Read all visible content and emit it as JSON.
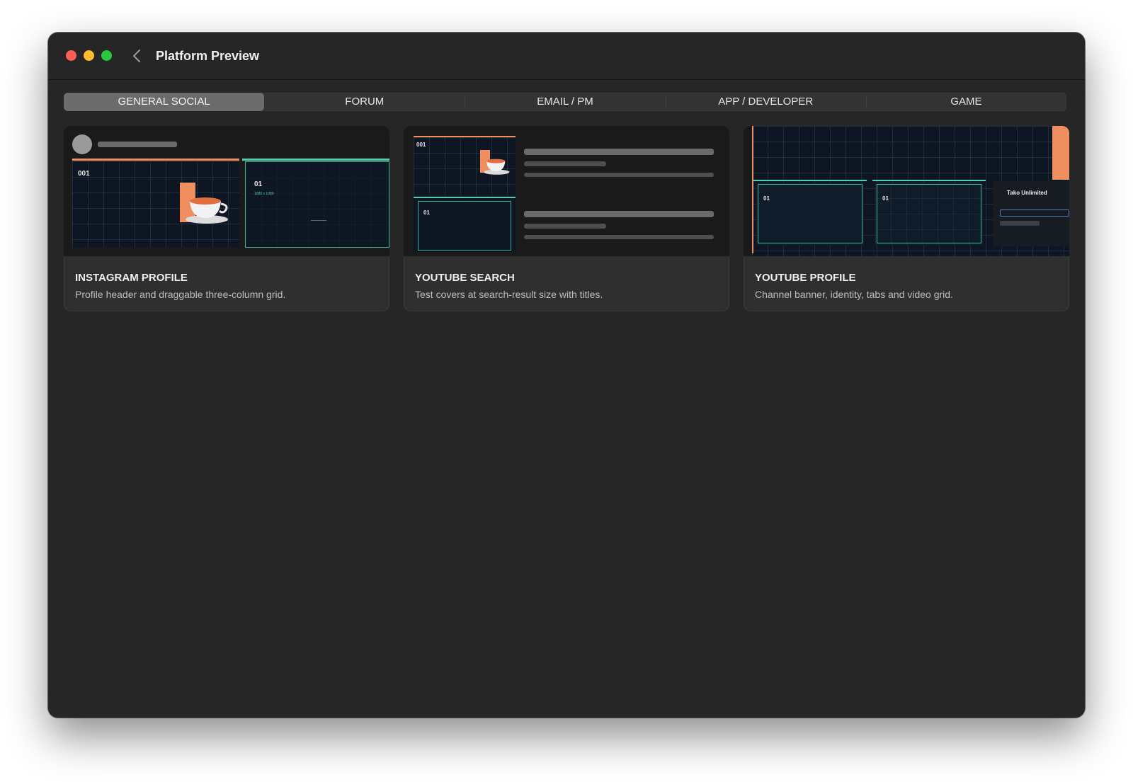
{
  "window": {
    "title": "Platform Preview"
  },
  "tabs": [
    {
      "label": "GENERAL SOCIAL",
      "active": true
    },
    {
      "label": "FORUM",
      "active": false
    },
    {
      "label": "EMAIL / PM",
      "active": false
    },
    {
      "label": "APP / DEVELOPER",
      "active": false
    },
    {
      "label": "GAME",
      "active": false
    }
  ],
  "cards": [
    {
      "title": "INSTAGRAM PROFILE",
      "description": "Profile header and draggable three-column grid.",
      "thumb": {
        "post1": "001",
        "post2": "01",
        "post2_size": "1080 x 1080"
      }
    },
    {
      "title": "YOUTUBE SEARCH",
      "description": "Test covers at search-result size with titles.",
      "thumb": {
        "cover1": "001",
        "cover2": "01"
      }
    },
    {
      "title": "YOUTUBE PROFILE",
      "description": "Channel banner, identity, tabs and video grid.",
      "thumb": {
        "video1": "01",
        "video2": "01",
        "channel_name": "Tako Unlimited"
      }
    }
  ],
  "colors": {
    "window_bg": "#262626",
    "accent_orange": "#ef8f5f",
    "accent_teal": "#4fd1b1",
    "close": "#ff5f57",
    "minimize": "#febc2e",
    "maximize": "#28c840"
  }
}
